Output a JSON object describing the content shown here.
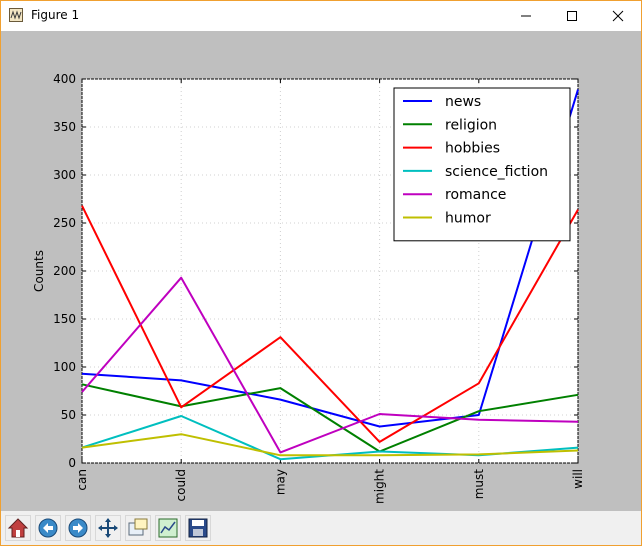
{
  "window": {
    "title": "Figure 1",
    "controls": {
      "minimize": "minimize",
      "maximize": "maximize",
      "close": "close"
    }
  },
  "toolbar": {
    "tools": [
      {
        "name": "home",
        "icon": "home-icon"
      },
      {
        "name": "back",
        "icon": "back-arrow-icon"
      },
      {
        "name": "forward",
        "icon": "forward-arrow-icon"
      },
      {
        "name": "pan",
        "icon": "pan-arrows-icon"
      },
      {
        "name": "zoom",
        "icon": "zoom-rect-icon"
      },
      {
        "name": "subplots",
        "icon": "subplots-icon"
      },
      {
        "name": "save",
        "icon": "floppy-disk-icon"
      }
    ]
  },
  "chart_data": {
    "type": "line",
    "title": "",
    "xlabel": "",
    "ylabel": "Counts",
    "categories": [
      "can",
      "could",
      "may",
      "might",
      "must",
      "will"
    ],
    "ylim": [
      0,
      400
    ],
    "yticks": [
      0,
      50,
      100,
      150,
      200,
      250,
      300,
      350,
      400
    ],
    "grid": true,
    "legend_position": "top-right",
    "series": [
      {
        "name": "news",
        "color": "#0000ff",
        "values": [
          93,
          86,
          66,
          38,
          50,
          389
        ]
      },
      {
        "name": "religion",
        "color": "#008000",
        "values": [
          82,
          59,
          78,
          12,
          54,
          71
        ]
      },
      {
        "name": "hobbies",
        "color": "#ff0000",
        "values": [
          268,
          58,
          131,
          22,
          83,
          264
        ]
      },
      {
        "name": "science_fiction",
        "color": "#00bfbf",
        "values": [
          16,
          49,
          4,
          12,
          8,
          16
        ]
      },
      {
        "name": "romance",
        "color": "#bf00bf",
        "values": [
          74,
          193,
          11,
          51,
          45,
          43
        ]
      },
      {
        "name": "humor",
        "color": "#bfbf00",
        "values": [
          16,
          30,
          8,
          8,
          9,
          13
        ]
      }
    ]
  }
}
